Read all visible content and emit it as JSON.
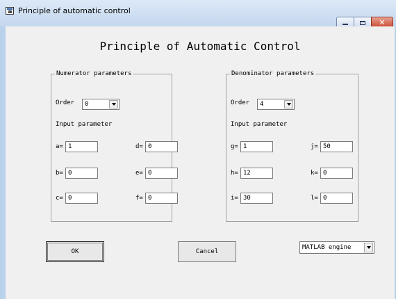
{
  "window": {
    "title": "Principle of automatic control"
  },
  "heading": "Principle of Automatic Control",
  "numerator": {
    "group_title": "Numerator parameters",
    "order_label": "Order",
    "order_value": "0",
    "input_label": "Input parameter",
    "fields": [
      {
        "label": "a=",
        "value": "1"
      },
      {
        "label": "d=",
        "value": "0"
      },
      {
        "label": "b=",
        "value": "0"
      },
      {
        "label": "e=",
        "value": "0"
      },
      {
        "label": "c=",
        "value": "0"
      },
      {
        "label": "f=",
        "value": "0"
      }
    ]
  },
  "denominator": {
    "group_title": "Denominator parameters",
    "order_label": "Order",
    "order_value": "4",
    "input_label": "Input parameter",
    "fields": [
      {
        "label": "g=",
        "value": "1"
      },
      {
        "label": "j=",
        "value": "50"
      },
      {
        "label": "h=",
        "value": "12"
      },
      {
        "label": "k=",
        "value": "0"
      },
      {
        "label": "i=",
        "value": "30"
      },
      {
        "label": "l=",
        "value": "0"
      }
    ]
  },
  "buttons": {
    "ok": "OK",
    "cancel": "Cancel"
  },
  "engine": {
    "value": "MATLAB engine"
  },
  "icons": [
    "app-icon",
    "minimize-icon",
    "maximize-icon",
    "close-icon",
    "dropdown-arrow-icon"
  ]
}
